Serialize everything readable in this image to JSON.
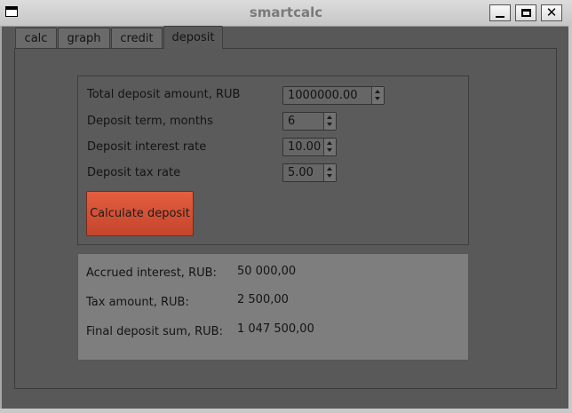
{
  "window": {
    "title": "smartcalc",
    "minimize_icon": "minimize-icon",
    "maximize_icon": "maximize-icon",
    "close_glyph": "✕"
  },
  "tabs": [
    {
      "label": "calc"
    },
    {
      "label": "graph"
    },
    {
      "label": "credit"
    },
    {
      "label": "deposit"
    }
  ],
  "active_tab": "deposit",
  "inputs": {
    "amount": {
      "label": "Total deposit amount, RUB",
      "value": "1000000.00"
    },
    "term": {
      "label": "Deposit term, months",
      "value": "6"
    },
    "interest_rate": {
      "label": "Deposit interest rate",
      "value": "10.00"
    },
    "tax_rate": {
      "label": "Deposit tax rate",
      "value": "5.00"
    }
  },
  "calculate_button": {
    "label": "Calculate deposit"
  },
  "results": {
    "accrued_interest": {
      "label": "Accrued interest, RUB:",
      "value": "50 000,00"
    },
    "tax_amount": {
      "label": "Tax amount, RUB:",
      "value": "2 500,00"
    },
    "final_sum": {
      "label": "Final deposit sum, RUB:",
      "value": "1 047 500,00"
    }
  },
  "colors": {
    "background": "#585858",
    "button_accent": "#d4502f",
    "results_panel": "#7e7e7e"
  }
}
